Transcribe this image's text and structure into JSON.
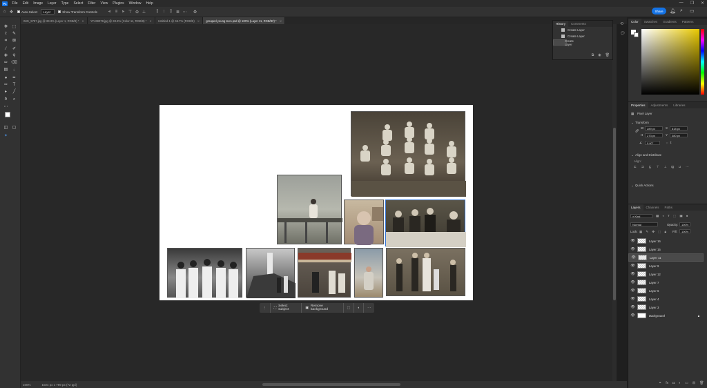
{
  "app": {
    "logo": "Ps"
  },
  "menu": [
    "File",
    "Edit",
    "Image",
    "Layer",
    "Type",
    "Select",
    "Filter",
    "View",
    "Plugins",
    "Window",
    "Help"
  ],
  "options": {
    "auto_select_label": "Auto-Select",
    "layer_select": "Layer",
    "show_transform_label": "Show Transform Controls",
    "share_label": "Share"
  },
  "tabs": [
    {
      "label": "IMG_9787.jpg @ 33.3% (Layer 1, RGB/8) *"
    },
    {
      "label": "YFJ69078.jpg @ 33.3% (Color 11, RGB/8) *"
    },
    {
      "label": "Untitled-1 @ 66.7% (RGB/8)"
    },
    {
      "label": "grouped young teen.psd @ 100% (Layer 11, RGB/8#) *",
      "active": true
    }
  ],
  "history": {
    "tabs": [
      "History",
      "Comments"
    ],
    "items": [
      "Create Layer",
      "Create Layer",
      "Create Layer"
    ]
  },
  "color_panel": {
    "tabs": [
      "Color",
      "Swatches",
      "Gradients",
      "Patterns"
    ]
  },
  "properties": {
    "tabs": [
      "Properties",
      "Adjustments",
      "Libraries"
    ],
    "layer_type": "Pixel Layer",
    "transform_label": "Transform",
    "w": "289 px",
    "h": "273 px",
    "x": "818 px",
    "y": "380 px",
    "angle": "0.00°",
    "align_label": "Align and Distribute",
    "align_sub": "Align:",
    "quick_actions_label": "Quick Actions"
  },
  "layers": {
    "tabs": [
      "Layers",
      "Channels",
      "Paths"
    ],
    "kind": "Kind",
    "blend_mode": "Normal",
    "opacity_label": "Opacity:",
    "opacity": "100%",
    "lock_label": "Lock:",
    "fill_label": "Fill:",
    "fill": "100%",
    "items": [
      {
        "name": "Layer 16",
        "selected": false
      },
      {
        "name": "Layer 15",
        "selected": false
      },
      {
        "name": "Layer 11",
        "selected": true
      },
      {
        "name": "Layer 9",
        "selected": false
      },
      {
        "name": "Layer 12",
        "selected": false
      },
      {
        "name": "Layer 7",
        "selected": false
      },
      {
        "name": "Layer 6",
        "selected": false
      },
      {
        "name": "Layer 4",
        "selected": false
      },
      {
        "name": "Layer 3",
        "selected": false
      },
      {
        "name": "Background",
        "selected": false,
        "background": true
      }
    ]
  },
  "context_bar": {
    "select_subject": "Select subject",
    "remove_background": "Remove background"
  },
  "status": {
    "zoom": "100%",
    "doc_info": "1024 px x 799 px (72 ppi)"
  }
}
